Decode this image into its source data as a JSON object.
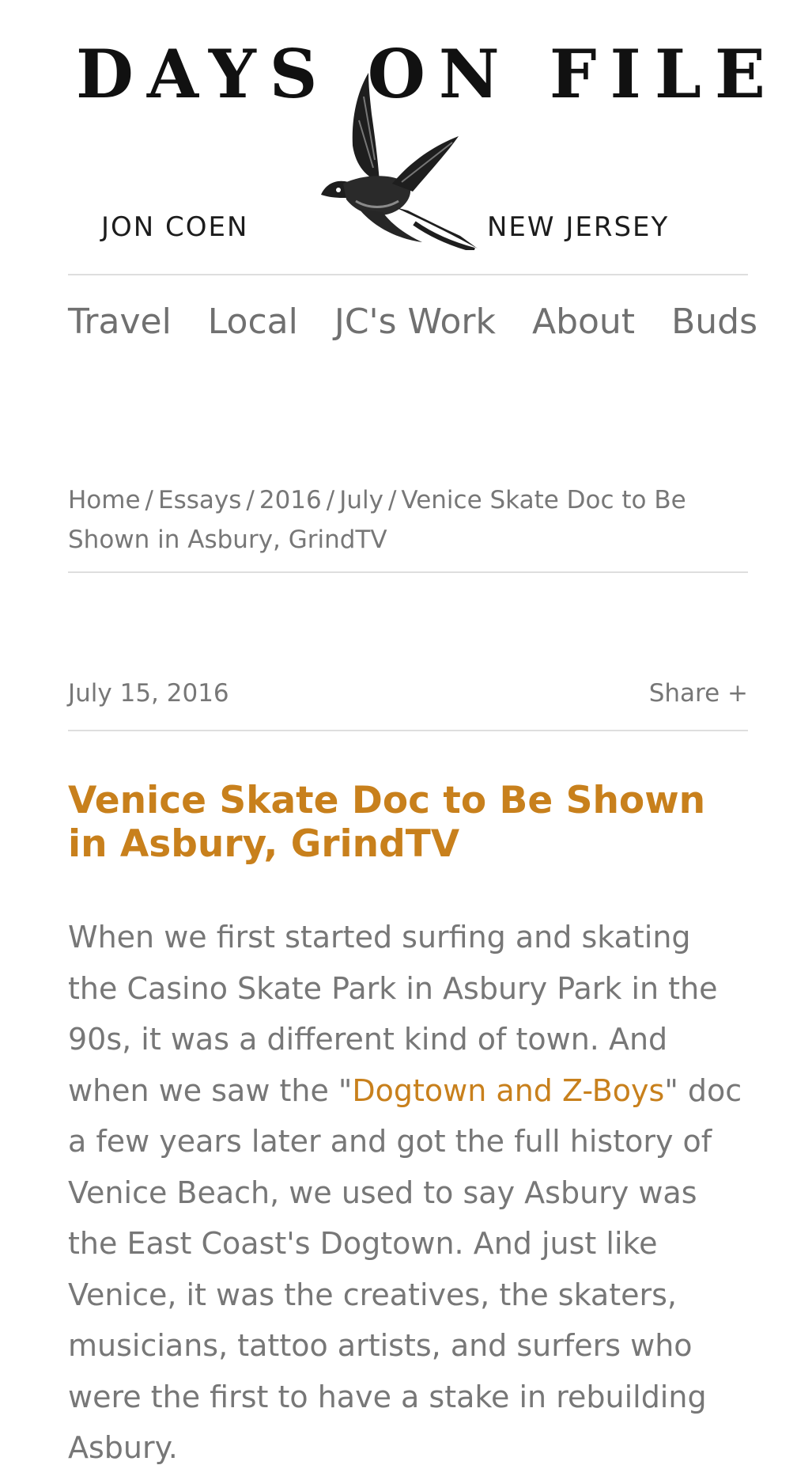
{
  "brand": {
    "logo_title": "DAYS ON FILE",
    "logo_left": "JON COEN",
    "logo_right": "NEW JERSEY"
  },
  "nav": {
    "items": [
      "Travel",
      "Local",
      "JC's Work",
      "About",
      "Buds"
    ]
  },
  "breadcrumb": {
    "items": [
      "Home",
      "Essays",
      "2016",
      "July",
      "Venice Skate Doc to Be Shown in Asbury, GrindTV"
    ],
    "separator": "/"
  },
  "post": {
    "date": "July 15, 2016",
    "share_label": "Share +",
    "title": "Venice Skate Doc to Be Shown in Asbury, GrindTV",
    "body_before_link": "When we first started surfing and skating the Casino Skate Park in Asbury Park in the 90s, it was a different kind of town. And when we saw the \"",
    "body_link": "Dogtown and Z-Boys",
    "body_after_link": "\" doc a few years later and got the full history of Venice Beach, we used to say Asbury was the East Coast's Dogtown. And just like Venice, it was the creatives, the skaters, musicians, tattoo artists, and surfers who were the first to have a stake in rebuilding Asbury."
  },
  "icons": {
    "logo_bird": "swallow-icon"
  },
  "colors": {
    "accent": "#c8801c",
    "text": "#777777",
    "rule": "#dedede"
  }
}
